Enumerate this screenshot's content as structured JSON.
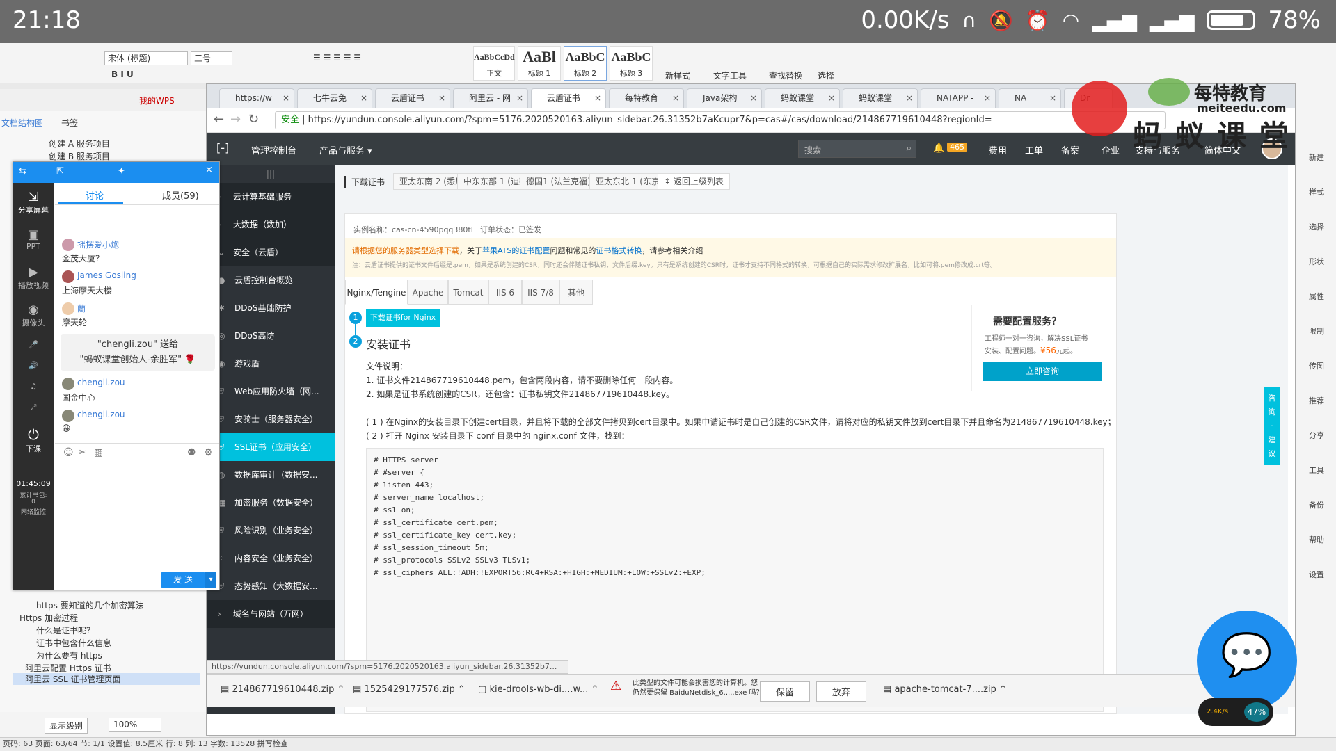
{
  "status": {
    "time": "21:18",
    "net": "0.00K/s",
    "battery": "78%"
  },
  "word": {
    "font": "宋体 (标题)",
    "size": "三号",
    "styles": [
      {
        "big": "AaBbCcDd",
        "name": "正文"
      },
      {
        "big": "AaBl",
        "name": "标题 1"
      },
      {
        "big": "AaBbC",
        "name": "标题 2"
      },
      {
        "big": "AaBbC",
        "name": "标题 3"
      }
    ],
    "tools": [
      "新样式",
      "文字工具",
      "查找替换",
      "选择"
    ],
    "row2": [
      "我的WPS"
    ],
    "docmap": {
      "tab1": "文档结构图",
      "tab2": "书签",
      "items": [
        "创建 A 服务项目",
        "创建 B 服务项目",
        "https 要知道的几个加密算法",
        "Https 加密过程",
        "什么是证书呢？",
        "证书中包含什么信息",
        "为什么要有 https",
        "阿里云配置 Https 证书",
        "阿里云 SSL 证书管理页面"
      ]
    },
    "zoom": {
      "level": "显示级别",
      "pct": "100%"
    },
    "status": "页码: 63  页面: 63/64  节: 1/1  设置值: 8.5厘米  行: 8  列: 13  字数: 13528  拼写检查",
    "right": [
      "新建",
      "样式",
      "选择",
      "形状",
      "属性",
      "限制",
      "传图",
      "推荐",
      "分享",
      "工具",
      "备份",
      "帮助",
      "设置"
    ]
  },
  "chat": {
    "tabs": {
      "discuss": "讨论",
      "members": "成员(59)"
    },
    "side": [
      "分享屏幕",
      "PPT",
      "播放视频",
      "摄像头",
      "下课"
    ],
    "timer": "01:45:09",
    "stat1": "累计书包:",
    "stat2": "0",
    "stat3": "网络监控",
    "messages": [
      {
        "name": "摇摆爱小炮",
        "text": "金茂大厦？"
      },
      {
        "name": "James Gosling",
        "text": "上海摩天大楼"
      },
      {
        "name": "蘭",
        "text": "摩天轮"
      },
      {
        "name": "chengli.zou",
        "text": "国金中心"
      },
      {
        "name": "chengli.zou",
        "text": "😀"
      }
    ],
    "gift1": "\"chengli.zou\" 送给",
    "gift2": "\"蚂蚁课堂创始人-余胜军\"",
    "send": "发 送"
  },
  "browser": {
    "tabs": [
      "https://w",
      "七牛云免",
      "云盾证书",
      "阿里云 - 网",
      "云盾证书",
      "每特教育",
      "Java架构",
      "蚂蚁课堂",
      "蚂蚁课堂",
      "NATAPP -",
      "NA",
      "Dr"
    ],
    "secure": "安全",
    "url": "https://yundun.console.aliyun.com/?spm=5176.2020520163.aliyun_sidebar.26.31352b7aKcupr7&p=cas#/cas/download/214867719610448?regionId=",
    "top": {
      "console": "管理控制台",
      "products": "产品与服务",
      "search": "搜索",
      "bell": "465",
      "fee": "费用",
      "ticket": "工单",
      "beian": "备案",
      "enterprise": "企业",
      "support": "支持与服务",
      "lang": "简体中文"
    },
    "sidenav": [
      {
        "label": "云计算基础服务",
        "type": "group"
      },
      {
        "label": "大数据（数加）",
        "type": "group"
      },
      {
        "label": "安全（云盾）",
        "type": "group"
      },
      {
        "label": "云盾控制台概览",
        "type": "item"
      },
      {
        "label": "DDoS基础防护",
        "type": "item"
      },
      {
        "label": "DDoS高防",
        "type": "item"
      },
      {
        "label": "游戏盾",
        "type": "item"
      },
      {
        "label": "Web应用防火墙（网...",
        "type": "item"
      },
      {
        "label": "安骑士（服务器安全）",
        "type": "item"
      },
      {
        "label": "SSL证书（应用安全）",
        "type": "active"
      },
      {
        "label": "数据库审计（数据安...",
        "type": "item"
      },
      {
        "label": "加密服务（数据安全）",
        "type": "item"
      },
      {
        "label": "风险识别（业务安全）",
        "type": "item"
      },
      {
        "label": "内容安全（业务安全）",
        "type": "item"
      },
      {
        "label": "态势感知（大数据安...",
        "type": "item"
      },
      {
        "label": "域名与网站（万网）",
        "type": "group"
      }
    ],
    "regions": {
      "title": "下载证书",
      "r": [
        "亚太东南 2 (悉尼)",
        "中东东部 1 (迪拜)",
        "德国1 (法兰克福)",
        "亚太东北 1 (东京)"
      ],
      "back": "返回上级列表"
    },
    "instance": "实例名称：cas-cn-4590pqq380tl",
    "order": "订单状态：已签发",
    "notice1a": "请根据您的服务器类型选择下载",
    "notice1b": "，关于",
    "notice1c": "苹果ATS的证书配置",
    "notice1d": "问题和常见的",
    "notice1e": "证书格式转换",
    "notice1f": "，请参考相关介绍",
    "notice2": "注：云盾证书提供的证书文件后缀是.pem，如果是系统创建的CSR，同时还会伴随证书私钥，文件后缀.key。只有是系统创建的CSR时，证书才支持不同格式的转换，可根据自己的实际需求修改扩展名，比如可将.pem修改成.crt等。",
    "servertabs": [
      "Nginx/Tengine",
      "Apache",
      "Tomcat",
      "IIS 6",
      "IIS 7/8",
      "其他"
    ],
    "download_btn": "下载证书for Nginx",
    "install": "安装证书",
    "file_title": "文件说明：",
    "file1": "1. 证书文件214867719610448.pem，包含两段内容，请不要删除任何一段内容。",
    "file2": "2. 如果是证书系统创建的CSR，还包含：证书私钥文件214867719610448.key。",
    "step1": "( 1 ) 在Nginx的安装目录下创建cert目录，并且将下载的全部文件拷贝到cert目录中。如果申请证书时是自己创建的CSR文件，请将对应的私钥文件放到cert目录下并且命名为214867719610448.key；",
    "step2": "( 2 ) 打开 Nginx 安装目录下 conf 目录中的 nginx.conf 文件，找到：",
    "code": "# HTTPS server\n# #server {\n# listen 443;\n# server_name localhost;\n# ssl on;\n# ssl_certificate cert.pem;\n# ssl_certificate_key cert.key;\n# ssl_session_timeout 5m;\n# ssl_protocols SSLv2 SSLv3 TLSv1;\n# ssl_ciphers ALL:!ADH:!EXPORT56:RC4+RSA:+HIGH:+MEDIUM:+LOW:+SSLv2:+EXP;",
    "help": {
      "title": "需要配置服务？",
      "l1": "工程师一对一咨询，解决SSL证书",
      "l2a": "安装、配置问题。",
      "price": "¥56",
      "l2b": "元起。",
      "btn": "立即咨询"
    },
    "float": [
      "咨",
      "询",
      "·",
      "建",
      "议"
    ],
    "hoverurl": "https://yundun.console.aliyun.com/?spm=5176.2020520163.aliyun_sidebar.26.31352b7...",
    "downloads": [
      {
        "name": "214867719610448.zip"
      },
      {
        "name": "1525429177576.zip"
      },
      {
        "name": "kie-drools-wb-di....w..."
      },
      {
        "name": "apache-tomcat-7....zip"
      }
    ],
    "warn1": "此类型的文件可能会损害您的计算机。您",
    "warn2": "仍然要保留 BaiduNetdisk_6.....exe 吗？",
    "keep": "保留",
    "discard": "放弃"
  },
  "watermark": {
    "t1": "每特教育",
    "t2": "meiteedu.com",
    "t3": "蚂 蚁 课 堂"
  },
  "bubble": {
    "pct": "47%",
    "speed": "2.4K/s"
  }
}
